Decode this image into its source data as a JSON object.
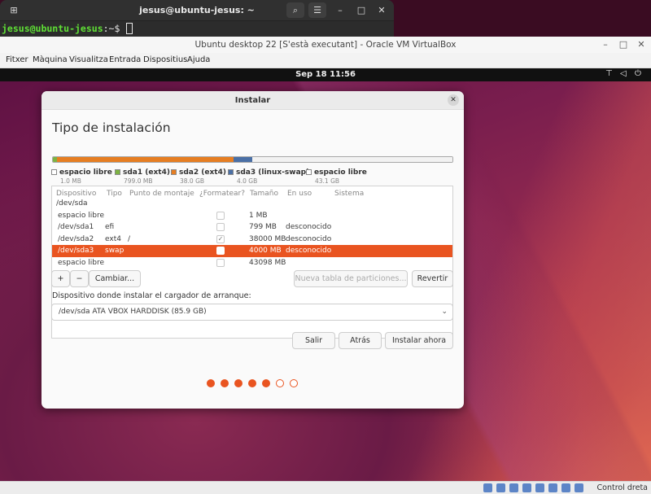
{
  "terminal": {
    "title": "jesus@ubuntu-jesus: ~",
    "prompt_user": "jesus@ubuntu-jesus",
    "prompt_rest": ":~$ "
  },
  "vbox": {
    "title": "Ubuntu desktop 22 [S'està executant] - Oracle VM VirtualBox",
    "menu": [
      "Fitxer",
      "Màquina",
      "Visualitza",
      "Entrada",
      "Dispositius",
      "Ajuda"
    ],
    "status_text": "Control dreta"
  },
  "guest": {
    "clock": "Sep 18  11:56"
  },
  "installer": {
    "window_title": "Instalar",
    "heading": "Tipo de instalación",
    "partition_bar": [
      {
        "name": "espacio libre",
        "fraction": 0.0001,
        "color": "#f2f2f2"
      },
      {
        "name": "sda1",
        "fraction": 0.0093,
        "color": "#7cb342"
      },
      {
        "name": "sda2",
        "fraction": 0.4425,
        "color": "#e67e22"
      },
      {
        "name": "sda3",
        "fraction": 0.0466,
        "color": "#4a6fa5"
      },
      {
        "name": "espacio libre",
        "fraction": 0.5016,
        "color": "#f2f2f2"
      }
    ],
    "legend": [
      {
        "name": "espacio libre",
        "size": "1.0 MB",
        "color": "#ffffff"
      },
      {
        "name": "sda1 (ext4)",
        "size": "799.0 MB",
        "color": "#7cb342"
      },
      {
        "name": "sda2 (ext4)",
        "size": "38.0 GB",
        "color": "#e67e22"
      },
      {
        "name": "sda3 (linux-swap)",
        "size": "4.0 GB",
        "color": "#4a6fa5"
      },
      {
        "name": "espacio libre",
        "size": "43.1 GB",
        "color": "#ffffff"
      }
    ],
    "columns": [
      "Dispositivo",
      "Tipo",
      "Punto de montaje",
      "¿Formatear?",
      "Tamaño",
      "En uso",
      "Sistema"
    ],
    "rows": [
      {
        "device": "/dev/sda",
        "type": "",
        "mount": "",
        "format": "none",
        "size": "",
        "used": "",
        "system": ""
      },
      {
        "device": "espacio libre",
        "type": "",
        "mount": "",
        "format": "unchecked",
        "size": "1 MB",
        "used": "",
        "system": ""
      },
      {
        "device": "/dev/sda1",
        "type": "efi",
        "mount": "",
        "format": "unchecked",
        "size": "799 MB",
        "used": "desconocido",
        "system": ""
      },
      {
        "device": "/dev/sda2",
        "type": "ext4",
        "mount": "/",
        "format": "checked",
        "size": "38000 MB",
        "used": "desconocido",
        "system": ""
      },
      {
        "device": "/dev/sda3",
        "type": "swap",
        "mount": "",
        "format": "unchecked",
        "size": "4000 MB",
        "used": "desconocido",
        "system": "",
        "selected": true
      },
      {
        "device": "espacio libre",
        "type": "",
        "mount": "",
        "format": "unchecked",
        "size": "43098 MB",
        "used": "",
        "system": ""
      }
    ],
    "buttons": {
      "add": "+",
      "remove": "−",
      "change": "Cambiar...",
      "new_table": "Nueva tabla de particiones...",
      "revert": "Revertir",
      "quit": "Salir",
      "back": "Atrás",
      "install": "Instalar ahora"
    },
    "bootloader_label": "Dispositivo donde instalar el cargador de arranque:",
    "bootloader_device": "/dev/sda   ATA VBOX HARDDISK (85.9 GB)",
    "steps_total": 7,
    "steps_done": 5,
    "accent_color": "#e95420"
  }
}
